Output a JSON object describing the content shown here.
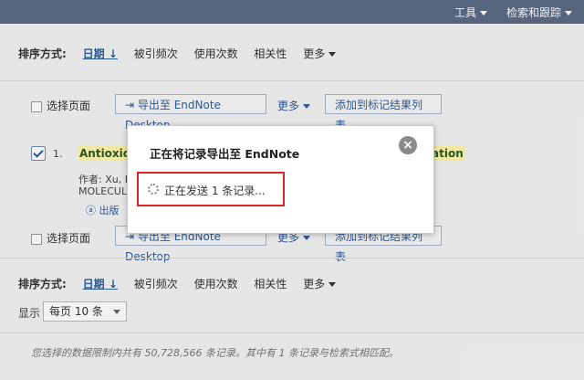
{
  "topbar": {
    "tools_label": "工具",
    "search_tracking_label": "检索和跟踪"
  },
  "sort_top": {
    "label": "排序方式:",
    "date": "日期",
    "cited": "被引频次",
    "usage": "使用次数",
    "relevance": "相关性",
    "more": "更多"
  },
  "toolbar_top": {
    "select_page": "选择页面",
    "export_button": "导出至 EndNote Desktop",
    "more": "更多",
    "add_marked": "添加到标记结果列表"
  },
  "result": {
    "index": "1.",
    "title_start": "Antioxida",
    "title_end": "ation",
    "authors_prefix": "作者: Xu, D",
    "journal": "MOLECULE",
    "publisher_link": "出版"
  },
  "toolbar_bottom": {
    "select_page": "选择页面",
    "export_button": "导出至 EndNote Desktop",
    "more": "更多",
    "add_marked": "添加到标记结果列表"
  },
  "sort_bottom": {
    "label": "排序方式:",
    "date": "日期",
    "cited": "被引频次",
    "usage": "使用次数",
    "relevance": "相关性",
    "more": "更多"
  },
  "display": {
    "label": "显示",
    "per_page": "每页 10 条"
  },
  "footer": {
    "note": "您选择的数据限制内共有 50,728,566 条记录。其中有 1 条记录与检索式相匹配。"
  },
  "modal": {
    "title": "正在将记录导出至 EndNote",
    "status": "正在发送 1 条记录..."
  }
}
